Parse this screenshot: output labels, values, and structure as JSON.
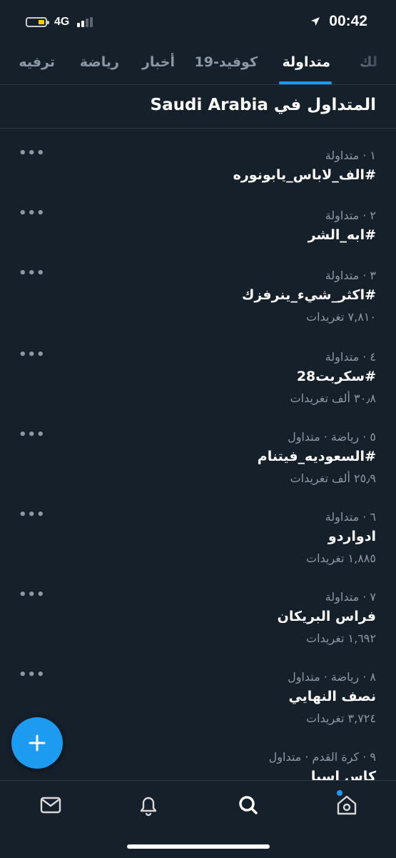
{
  "status_bar": {
    "network": "4G",
    "time": "00:42",
    "battery_level": 0.3,
    "signal_bars": 2
  },
  "tabs": [
    {
      "label": "لك",
      "active": false
    },
    {
      "label": "متداولة",
      "active": true
    },
    {
      "label": "كوفيد-19",
      "active": false
    },
    {
      "label": "أخبار",
      "active": false
    },
    {
      "label": "رياضة",
      "active": false
    },
    {
      "label": "ترفيه",
      "active": false
    }
  ],
  "section": {
    "title": "المتداول في Saudi Arabia"
  },
  "trends": [
    {
      "meta": "١ · متداولة",
      "name": "#الف_لاباس_يابونوره",
      "count": ""
    },
    {
      "meta": "٢ · متداولة",
      "name": "#ابه_الشر",
      "count": ""
    },
    {
      "meta": "٣ · متداولة",
      "name": "#اكثر_شيء_ينرفزك",
      "count": "٧,٨١٠ تغريدات"
    },
    {
      "meta": "٤ · متداولة",
      "name": "#سكربت28",
      "count": "٣٠٫٨ ألف تغريدات"
    },
    {
      "meta": "٥ · رياضة · متداول",
      "name": "#السعوديه_فيتنام",
      "count": "٢٥٫٩ ألف تغريدات"
    },
    {
      "meta": "٦ · متداولة",
      "name": "ادواردو",
      "count": "١,٨٨٥ تغريدات"
    },
    {
      "meta": "٧ · متداولة",
      "name": "فراس البريكان",
      "count": "١,٦٩٢ تغريدات"
    },
    {
      "meta": "٨ · رياضة · متداول",
      "name": "نصف النهايي",
      "count": "٣,٧٢٤ تغريدات"
    },
    {
      "meta": "٩ · كرة القدم · متداول",
      "name": "كاس اسيا",
      "count": ""
    }
  ],
  "more_label": "•••",
  "bottom_nav": [
    {
      "icon": "mail-icon"
    },
    {
      "icon": "bell-icon"
    },
    {
      "icon": "search-icon",
      "active": true
    },
    {
      "icon": "home-icon",
      "badge": true
    }
  ],
  "colors": {
    "background": "#15202b",
    "accent": "#1d9bf0",
    "muted": "#8b98a5"
  }
}
